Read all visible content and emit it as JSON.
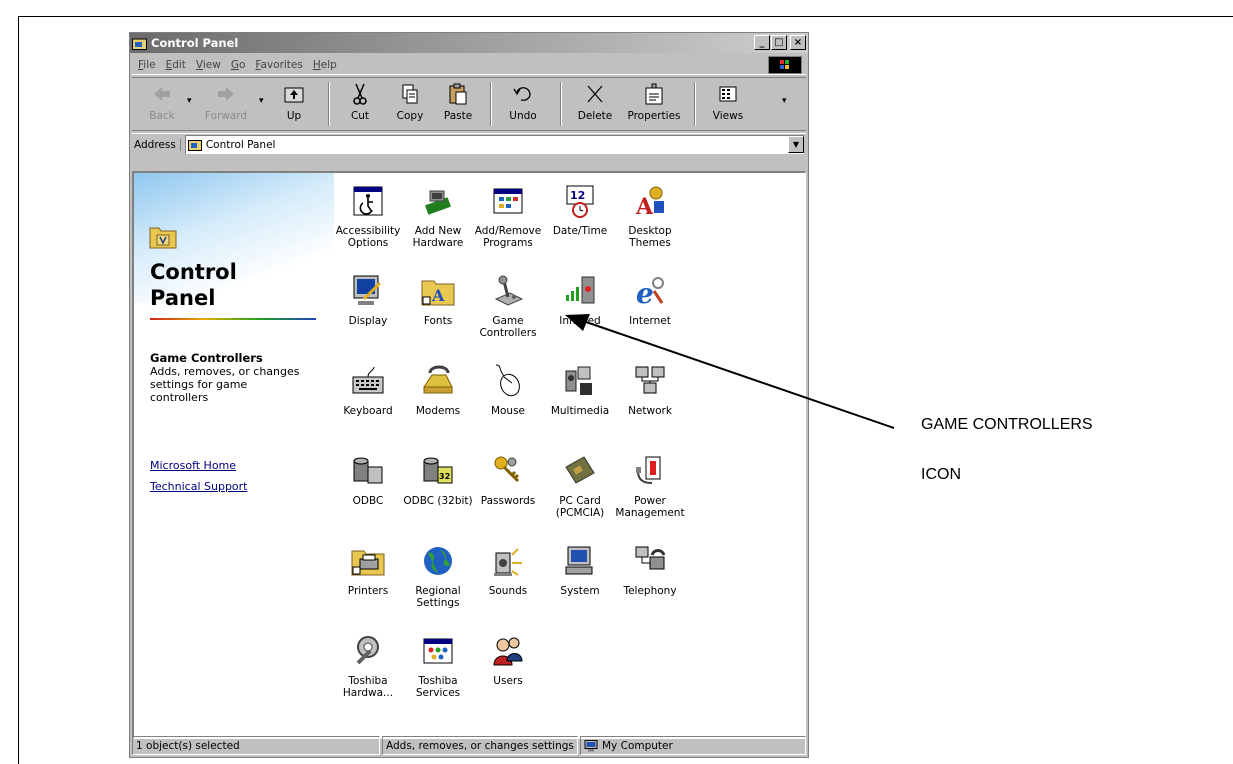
{
  "figure": {
    "caption": ""
  },
  "window": {
    "title": "Control Panel",
    "caption_buttons": {
      "minimize": "_",
      "maximize": "□",
      "close": "×"
    }
  },
  "menu": [
    "File",
    "Edit",
    "View",
    "Go",
    "Favorites",
    "Help"
  ],
  "toolbar": {
    "back": "Back",
    "forward": "Forward",
    "up": "Up",
    "cut": "Cut",
    "copy": "Copy",
    "paste": "Paste",
    "undo": "Undo",
    "delete": "Delete",
    "properties": "Properties",
    "views": "Views"
  },
  "address": {
    "label": "Address",
    "value": "Control Panel"
  },
  "left_pane": {
    "title_line1": "Control",
    "title_line2": "Panel",
    "selected_title": "Game Controllers",
    "selected_desc": "Adds, removes, or changes settings for game controllers",
    "links": [
      "Microsoft Home",
      "Technical Support"
    ]
  },
  "icons": [
    {
      "label": "Accessibility Options",
      "icon": "accessibility-icon"
    },
    {
      "label": "Add New Hardware",
      "icon": "hardware-icon"
    },
    {
      "label": "Add/Remove Programs",
      "icon": "programs-icon"
    },
    {
      "label": "Date/Time",
      "icon": "clock-icon"
    },
    {
      "label": "Desktop Themes",
      "icon": "themes-icon"
    },
    {
      "label": "Display",
      "icon": "monitor-icon"
    },
    {
      "label": "Fonts",
      "icon": "font-folder-icon"
    },
    {
      "label": "Game Controllers",
      "icon": "joystick-icon"
    },
    {
      "label": "Infrared",
      "icon": "infrared-icon"
    },
    {
      "label": "Internet",
      "icon": "internet-icon"
    },
    {
      "label": "Keyboard",
      "icon": "keyboard-icon"
    },
    {
      "label": "Modems",
      "icon": "modem-icon"
    },
    {
      "label": "Mouse",
      "icon": "mouse-icon"
    },
    {
      "label": "Multimedia",
      "icon": "multimedia-icon"
    },
    {
      "label": "Network",
      "icon": "network-icon"
    },
    {
      "label": "ODBC",
      "icon": "database-icon"
    },
    {
      "label": "ODBC (32bit)",
      "icon": "database32-icon"
    },
    {
      "label": "Passwords",
      "icon": "keys-icon"
    },
    {
      "label": "PC Card (PCMCIA)",
      "icon": "pccard-icon"
    },
    {
      "label": "Power Management",
      "icon": "power-icon"
    },
    {
      "label": "Printers",
      "icon": "printer-icon"
    },
    {
      "label": "Regional Settings",
      "icon": "globe-icon"
    },
    {
      "label": "Sounds",
      "icon": "speaker-icon"
    },
    {
      "label": "System",
      "icon": "computer-icon"
    },
    {
      "label": "Telephony",
      "icon": "telephone-icon"
    },
    {
      "label": "Toshiba Hardwa...",
      "icon": "wrench-icon"
    },
    {
      "label": "Toshiba Services",
      "icon": "services-icon"
    },
    {
      "label": "Users",
      "icon": "users-icon"
    }
  ],
  "statusbar": {
    "selection": "1 object(s) selected",
    "description": "Adds, removes, or changes settings",
    "zone": "My Computer"
  },
  "annotation": {
    "line1": "GAME CONTROLLERS",
    "line2": "ICON"
  }
}
